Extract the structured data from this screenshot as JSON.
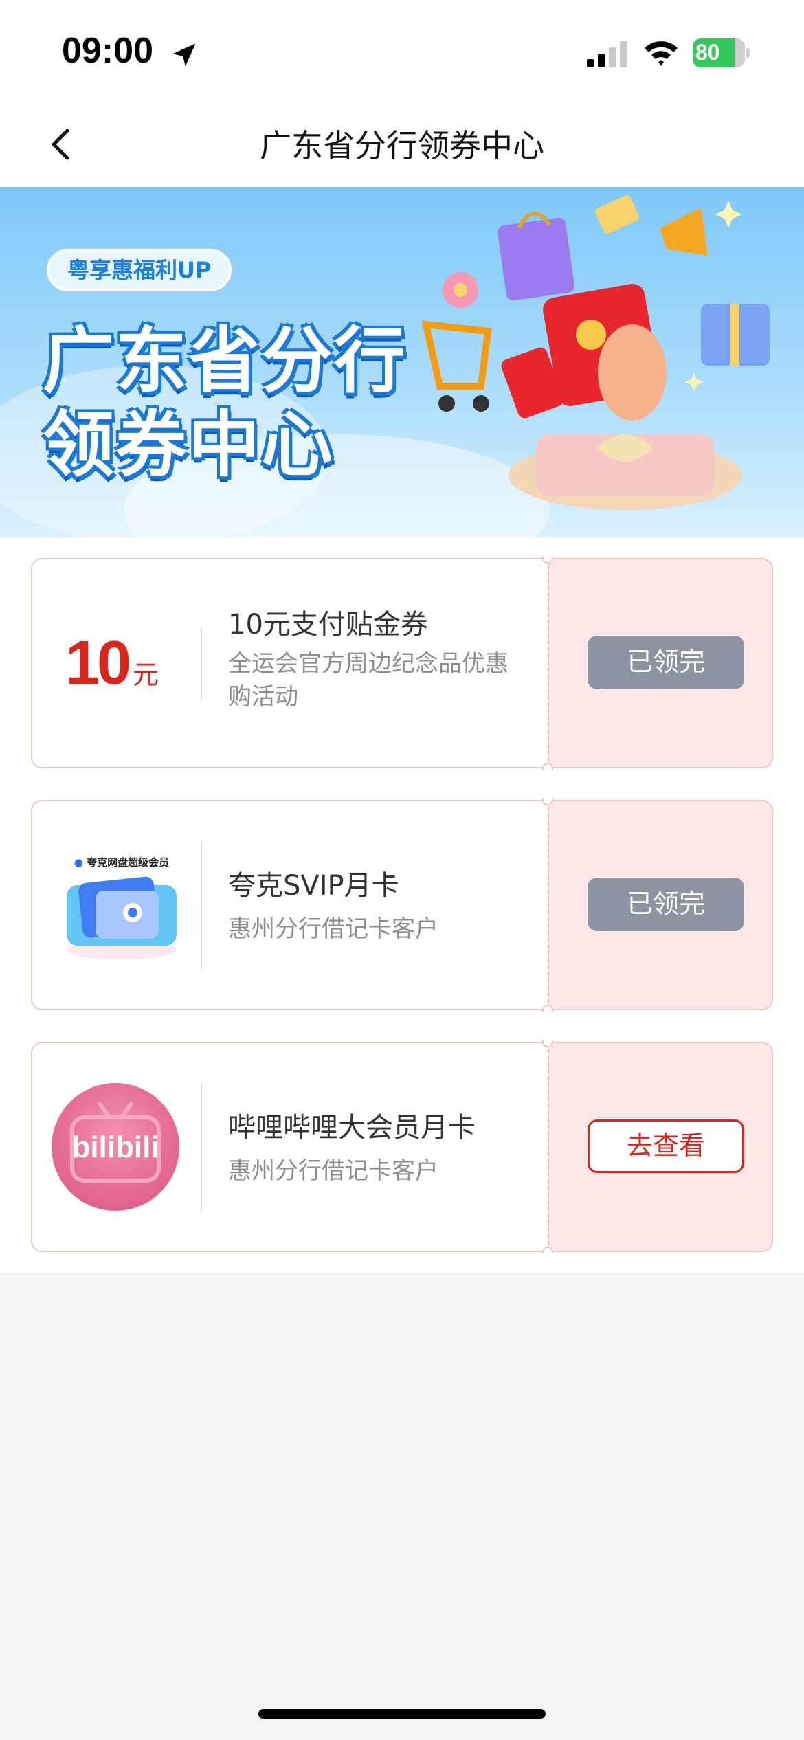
{
  "status_bar": {
    "time": "09:00",
    "battery_text": "80",
    "battery_level": 0.8,
    "icons": [
      "location-arrow-icon",
      "signal-icon",
      "wifi-icon",
      "battery-icon"
    ]
  },
  "nav": {
    "title": "广东省分行领券中心",
    "back_icon": "chevron-left-icon"
  },
  "banner": {
    "tag": "粤享惠福利UP",
    "title_line1": "广东省分行",
    "title_line2": "领券中心"
  },
  "coupons": [
    {
      "amount": "10",
      "unit": "元",
      "title": "10元支付贴金券",
      "desc": "全运会官方周边纪念品优惠购活动",
      "button": "已领完",
      "state": "claimed"
    },
    {
      "logo_caption": "夸克网盘超级会员",
      "title": "夸克SVIP月卡",
      "desc": "惠州分行借记卡客户",
      "button": "已领完",
      "state": "claimed"
    },
    {
      "logo_text": "bilibili",
      "title": "哔哩哔哩大会员月卡",
      "desc": "惠州分行借记卡客户",
      "button": "去查看",
      "state": "view"
    }
  ],
  "colors": {
    "accent_red": "#d8261c",
    "coupon_stub_bg": "#fde8e7",
    "claimed_button": "#8c94a1",
    "battery_green": "#34c759"
  }
}
